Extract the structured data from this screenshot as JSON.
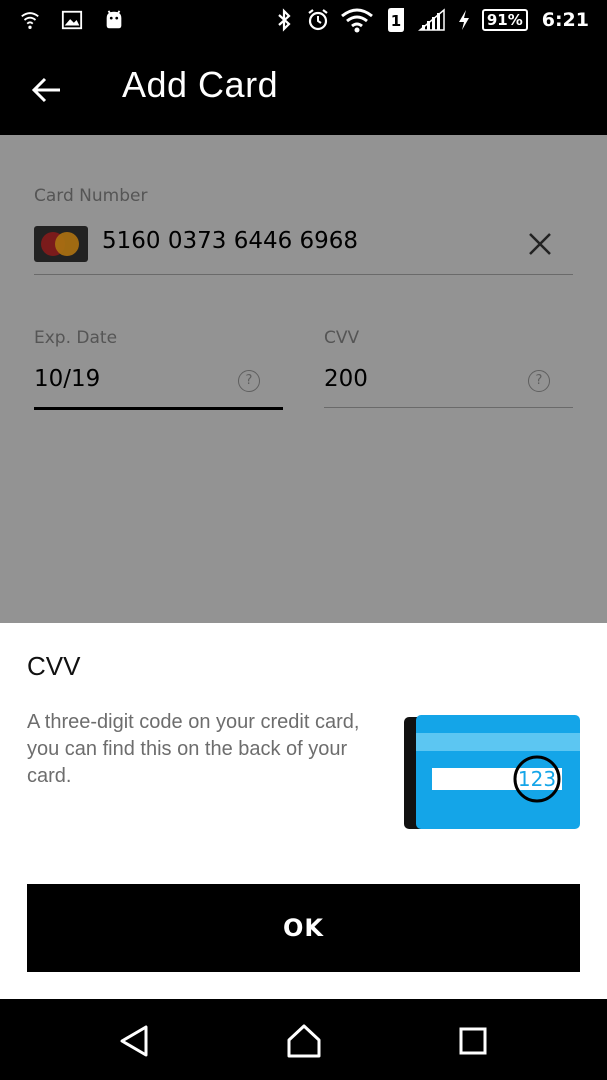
{
  "status_bar": {
    "battery_percent": "91%",
    "time": "6:21",
    "sim_slot": "1",
    "icons": [
      "cast-icon",
      "image-icon",
      "android-icon",
      "bluetooth-icon",
      "alarm-icon",
      "wifi-icon",
      "sim-icon",
      "signal-icon",
      "charging-icon",
      "battery-icon"
    ]
  },
  "app_bar": {
    "title": "Add Card"
  },
  "form": {
    "card_number": {
      "label": "Card Number",
      "value": "5160 0373 6446 6968"
    },
    "exp_date": {
      "label": "Exp. Date",
      "value": "10/19"
    },
    "cvv": {
      "label": "CVV",
      "value": "200"
    },
    "help_glyph": "?"
  },
  "sheet": {
    "title": "CVV",
    "description": "A three-digit code on your credit card, you can find this on the back of your card.",
    "illustration_code": "123",
    "ok_label": "OK"
  },
  "colors": {
    "illustration_blue": "#14a5e8",
    "overlay_gray": "#939393"
  }
}
